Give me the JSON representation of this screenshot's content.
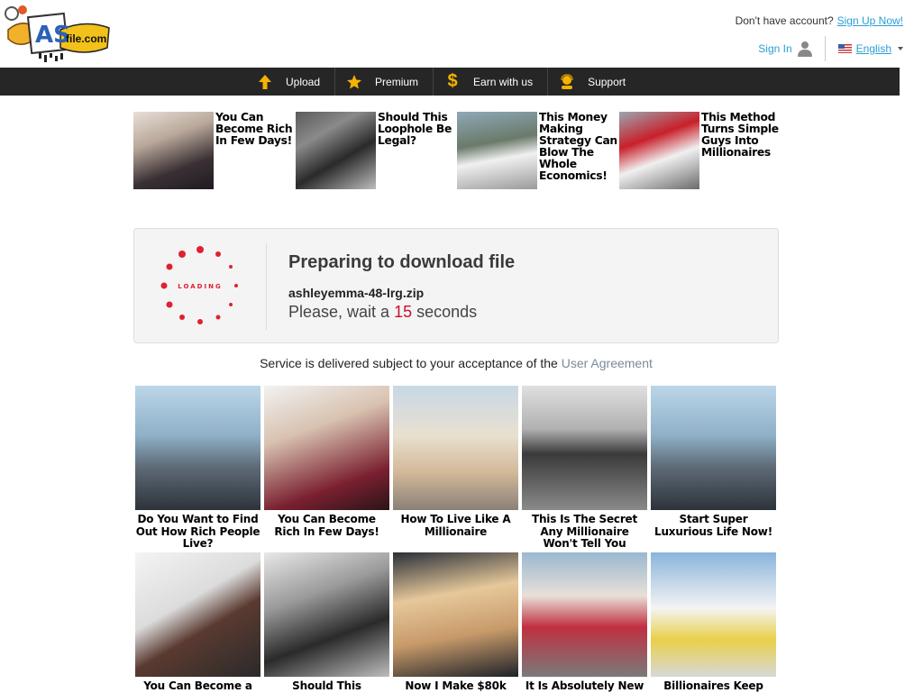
{
  "header": {
    "logo_text": "AS",
    "logo_domain": "file.com",
    "account_prompt": "Don't have account?",
    "signup_link": "Sign Up Now!",
    "signin_label": "Sign In",
    "language_label": "English"
  },
  "nav": [
    {
      "label": "Upload",
      "icon": "upload-arrow-icon"
    },
    {
      "label": "Premium",
      "icon": "star-icon"
    },
    {
      "label": "Earn with us",
      "icon": "dollar-icon"
    },
    {
      "label": "Support",
      "icon": "support-agent-icon"
    }
  ],
  "top_ads": [
    {
      "text": "You Can Become Rich In Few Days!"
    },
    {
      "text": "Should This Loophole Be Legal?"
    },
    {
      "text": "This Money Making Strategy Can Blow The Whole Economics!"
    },
    {
      "text": "This Method Turns Simple Guys Into Millionaires"
    }
  ],
  "download": {
    "loading_text": "LOADING",
    "title": "Preparing to download file",
    "filename": "ashleyemma-48-lrg.zip",
    "wait_prefix": "Please, wait a",
    "seconds": "15",
    "wait_suffix": "seconds"
  },
  "agreement": {
    "text": "Service is delivered subject to your acceptance of the",
    "link": "User Agreement"
  },
  "grid_ads_row1": [
    {
      "caption": "Do You Want to Find Out How Rich People Live?"
    },
    {
      "caption": "You Can Become Rich In Few Days!"
    },
    {
      "caption": "How To Live Like A Millionaire"
    },
    {
      "caption": "This Is The Secret Any Millionaire Won't Tell You"
    },
    {
      "caption": "Start Super Luxurious Life Now!"
    }
  ],
  "grid_ads_row2": [
    {
      "caption": "You Can Become a"
    },
    {
      "caption": "Should This"
    },
    {
      "caption": "Now I Make $80k"
    },
    {
      "caption": "It Is Absolutely New"
    },
    {
      "caption": "Billionaires Keep"
    }
  ],
  "colors": {
    "nav_bg": "#262626",
    "link_blue": "#2a9fd6",
    "seconds_red": "#c8102e",
    "loader_red": "#e02030",
    "box_bg": "#f4f4f4"
  }
}
